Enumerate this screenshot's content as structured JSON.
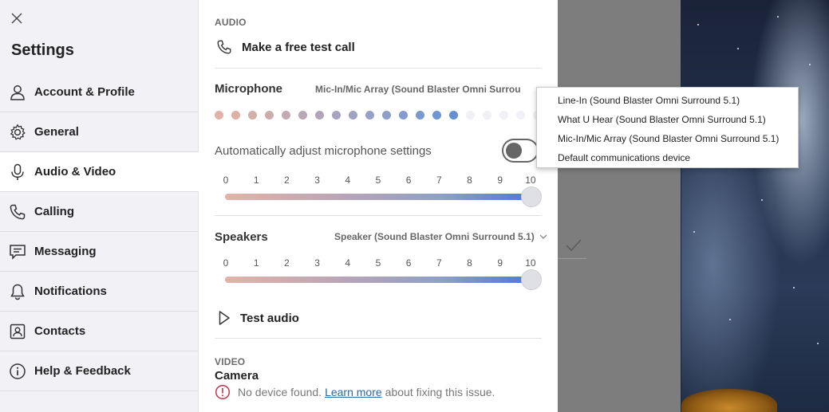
{
  "sidebar": {
    "title": "Settings",
    "items": [
      {
        "label": "Account & Profile",
        "icon": "person-icon"
      },
      {
        "label": "General",
        "icon": "gear-icon"
      },
      {
        "label": "Audio & Video",
        "icon": "microphone-icon",
        "active": true
      },
      {
        "label": "Calling",
        "icon": "phone-icon"
      },
      {
        "label": "Messaging",
        "icon": "chat-icon"
      },
      {
        "label": "Notifications",
        "icon": "bell-icon"
      },
      {
        "label": "Contacts",
        "icon": "contact-card-icon"
      },
      {
        "label": "Help & Feedback",
        "icon": "info-icon"
      }
    ]
  },
  "audio": {
    "section": "AUDIO",
    "test_call": "Make a free test call",
    "microphone": {
      "label": "Microphone",
      "device": "Mic-In/Mic Array (Sound Blaster Omni Surrou",
      "level_dots_lit": 15,
      "level_dots_total": 20,
      "dot_colors": [
        "#e3b1a8",
        "#dcb0a6",
        "#d4afa8",
        "#ccadab",
        "#c2aab0",
        "#b9a7b4",
        "#b0a5b9",
        "#a8a3be",
        "#a0a2c2",
        "#97a0c6",
        "#8e9fca",
        "#849ccd",
        "#7a99cf",
        "#6f96d1",
        "#6490d2",
        "#f0f1f4",
        "#f0f1f4",
        "#f0f1f4",
        "#f0f1f4",
        "#f0f1f4"
      ],
      "auto_adjust_label": "Automatically adjust microphone settings",
      "auto_adjust": false,
      "volume": 10
    },
    "speakers": {
      "label": "Speakers",
      "device": "Speaker (Sound Blaster Omni Surround 5.1)",
      "volume": 10
    },
    "scale_ticks": [
      "0",
      "1",
      "2",
      "3",
      "4",
      "5",
      "6",
      "7",
      "8",
      "9",
      "10"
    ],
    "test_audio": "Test audio"
  },
  "video": {
    "section": "VIDEO",
    "camera_label": "Camera",
    "warning_prefix": "No device found.",
    "warning_link": "Learn more",
    "warning_suffix": "about fixing this issue."
  },
  "microphone_dropdown": {
    "options": [
      "Line-In (Sound Blaster Omni Surround 5.1)",
      "What U Hear (Sound Blaster Omni Surround 5.1)",
      "Mic-In/Mic Array (Sound Blaster Omni Surround 5.1)",
      "Default communications device"
    ]
  },
  "colors": {
    "accent": "#4a7bd3",
    "sidebar_bg": "#f1f1f6",
    "link": "#2b6aa8",
    "warning": "#c4314b"
  }
}
